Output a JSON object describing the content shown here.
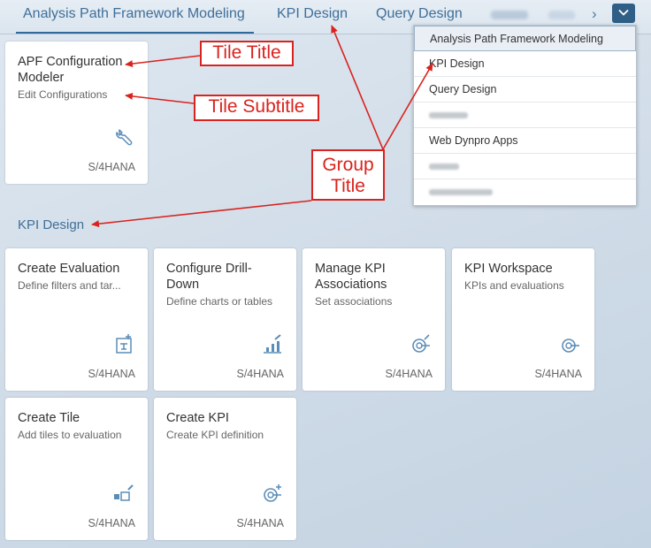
{
  "tabs": [
    {
      "label": "Analysis Path Framework Modeling"
    },
    {
      "label": "KPI Design"
    },
    {
      "label": "Query Design"
    }
  ],
  "group_title": "KPI Design",
  "first_group_tiles": [
    {
      "title": "APF Configuration Modeler",
      "subtitle": "Edit Configurations",
      "info": "S/4HANA",
      "icon": "wrench-icon"
    }
  ],
  "kpi_tiles": [
    {
      "title": "Create Evaluation",
      "subtitle": "Define filters and tar...",
      "info": "S/4HANA",
      "icon": "evaluation-icon"
    },
    {
      "title": "Configure Drill-Down",
      "subtitle": "Define charts or tables",
      "info": "S/4HANA",
      "icon": "drilldown-chart-icon"
    },
    {
      "title": "Manage KPI Associations",
      "subtitle": "Set associations",
      "info": "S/4HANA",
      "icon": "kpi-association-icon"
    },
    {
      "title": "KPI Workspace",
      "subtitle": "KPIs and evaluations",
      "info": "S/4HANA",
      "icon": "kpi-target-icon"
    },
    {
      "title": "Create Tile",
      "subtitle": "Add tiles to evaluation",
      "info": "S/4HANA",
      "icon": "tile-add-icon"
    },
    {
      "title": "Create KPI",
      "subtitle": "Create KPI definition",
      "info": "S/4HANA",
      "icon": "kpi-create-icon"
    }
  ],
  "overflow_menu": [
    {
      "label": "Analysis Path Framework Modeling",
      "selected": true
    },
    {
      "label": "KPI Design"
    },
    {
      "label": "Query Design"
    },
    {
      "label": ""
    },
    {
      "label": "Web Dynpro Apps"
    },
    {
      "label": ""
    },
    {
      "label": ""
    }
  ],
  "annotations": {
    "tile_title": "Tile Title",
    "tile_subtitle": "Tile Subtitle",
    "group_title_line1": "Group",
    "group_title_line2": "Title"
  },
  "colors": {
    "accent": "#3f6f99",
    "callout": "#d9231e",
    "overflow_button": "#2f5f86"
  }
}
